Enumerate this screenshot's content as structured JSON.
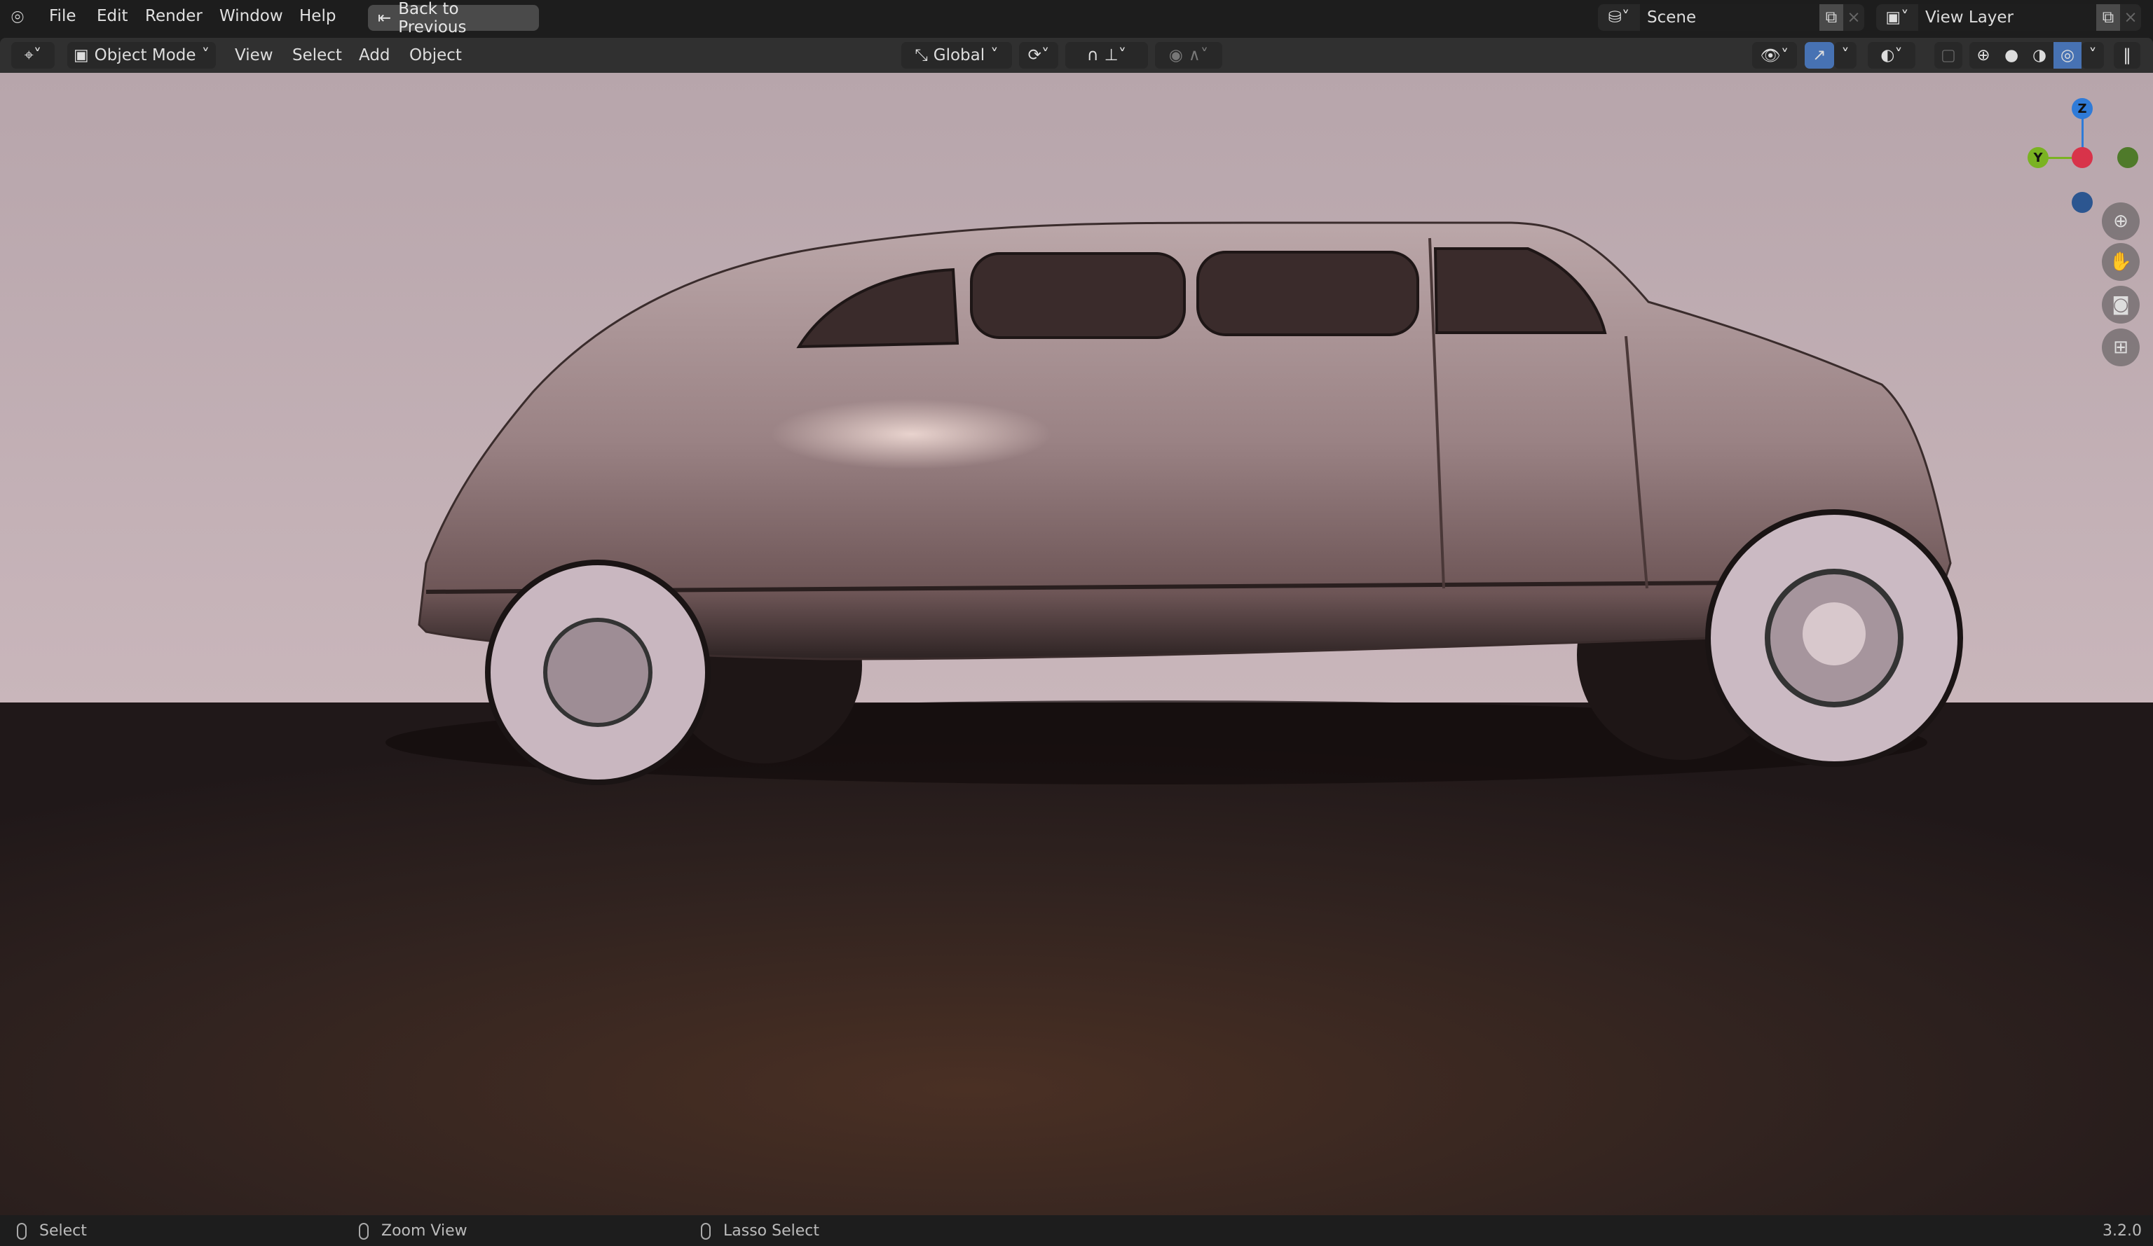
{
  "menu": {
    "file": "File",
    "edit": "Edit",
    "render": "Render",
    "window": "Window",
    "help": "Help",
    "back": "Back to Previous"
  },
  "scene": {
    "label": "Scene",
    "view_layer": "View Layer"
  },
  "toolbar": {
    "mode": "Object Mode",
    "view": "View",
    "select": "Select",
    "add": "Add",
    "object": "Object",
    "orientation": "Global"
  },
  "gizmo": {
    "z": "Z",
    "y": "Y"
  },
  "status": {
    "select": "Select",
    "zoom": "Zoom View",
    "lasso": "Lasso Select",
    "version": "3.2.0"
  },
  "colors": {
    "accent": "#4772b3",
    "x_axis": "#d8334a",
    "y_axis": "#7ab322",
    "z_axis": "#2f7bd8"
  }
}
